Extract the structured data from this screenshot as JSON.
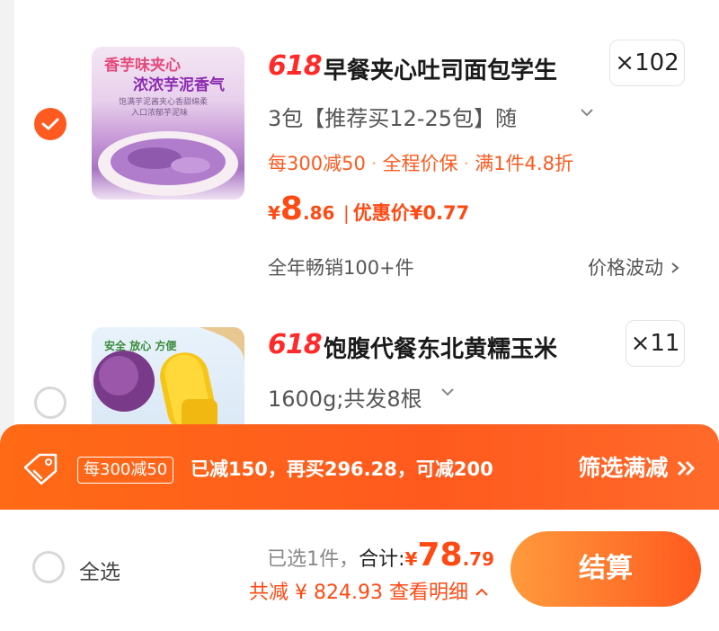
{
  "items": [
    {
      "selected": true,
      "badge": "618",
      "title": "早餐夹心吐司面包学生",
      "quantity": "×102",
      "spec": "3包【推荐买12-25包】随",
      "promos": [
        "每300减50",
        "全程价保",
        "满1件4.8折"
      ],
      "price_symbol": "¥",
      "price_int": "8",
      "price_dec": ".86",
      "price_sep": "|",
      "discount_price": "优惠价¥0.77",
      "sales": "全年畅销100+件",
      "price_trend": "价格波动",
      "image_text_1": "香芋味夹心",
      "image_text_2": "浓浓芋泥香气",
      "image_text_3": "饱满芋泥酱夹心香甜绵柔",
      "image_text_4": "入口浓郁芋泥味"
    },
    {
      "selected": false,
      "badge": "618",
      "title": "饱腹代餐东北黄糯玉米",
      "quantity": "×11",
      "spec": "1600g;共发8根",
      "image_text_1": "安全",
      "image_text_2": "放心",
      "image_text_3": "方便"
    }
  ],
  "promo_banner": {
    "coupon": "每300减50",
    "message": "已减150，再买296.28，可减200",
    "link": "筛选满减"
  },
  "footer": {
    "select_all": "全选",
    "selected_count": "已选1件，",
    "total_label": "合计:",
    "total_symbol": "¥",
    "total_int": "78",
    "total_dec": ".79",
    "discount_label": "共减",
    "discount_amount": "¥ 824.93",
    "detail_link": "查看明细",
    "checkout": "结算"
  },
  "colors": {
    "accent": "#ff5a1f",
    "price": "#ff4a14",
    "badge618": "#ff2a2a"
  }
}
